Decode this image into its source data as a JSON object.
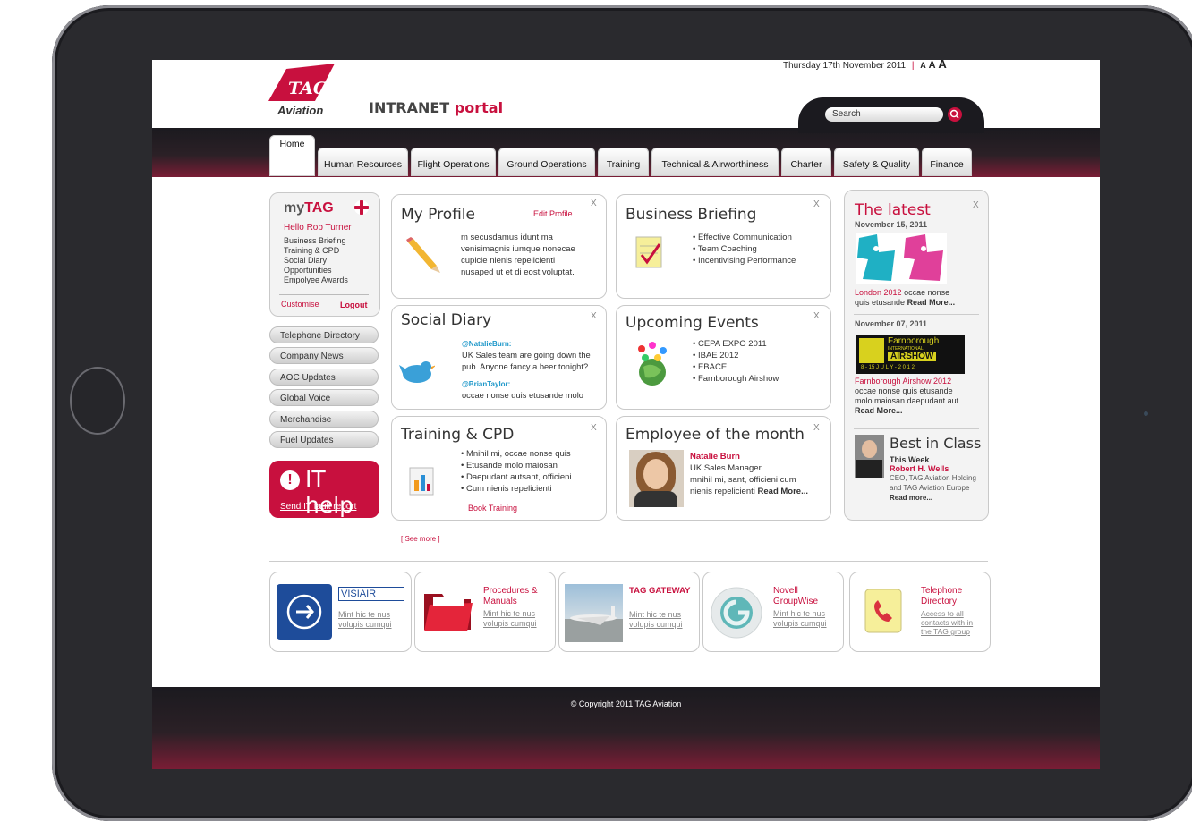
{
  "header": {
    "date": "Thursday 17th November 2011",
    "separator": "|",
    "font_size_a1": "A",
    "font_size_a2": "A",
    "font_size_a3": "A",
    "logo_text": "TAG",
    "logo_sub": "Aviation",
    "portal_word1": "INTRANET",
    "portal_word2": "portal",
    "search_label": "Search"
  },
  "tabs": [
    "Home",
    "Human Resources",
    "Flight Operations",
    "Ground Operations",
    "Training",
    "Technical & Airworthiness",
    "Charter",
    "Safety & Quality",
    "Finance"
  ],
  "mytag": {
    "title_my": "my",
    "title_tag": "TAG",
    "greeting": "Hello Rob Turner",
    "items": [
      "Business Briefing",
      "Training & CPD",
      "Social Diary",
      "Opportunities",
      "Empolyee Awards"
    ],
    "customise": "Customise",
    "logout": "Logout"
  },
  "sidenav": [
    "Telephone Directory",
    "Company News",
    "AOC Updates",
    "Global Voice",
    "Merchandise",
    "Fuel Updates"
  ],
  "ithelp": {
    "title": "IT help",
    "link": "Send IT fault report"
  },
  "profile": {
    "title": "My Profile",
    "edit": "Edit Profile",
    "close": "X",
    "text": [
      "m secusdamus idunt ma",
      "venisimagnis iumque nonecae",
      "cupicie nienis repelicienti",
      "nusaped ut et di eost voluptat."
    ]
  },
  "briefing": {
    "title": "Business Briefing",
    "close": "X",
    "items": [
      "• Effective Communication",
      "• Team Coaching",
      "• Incentivising Performance"
    ]
  },
  "social": {
    "title": "Social Diary",
    "close": "X",
    "user1": "@NatalieBurn:",
    "msg1a": "UK Sales team are going down the",
    "msg1b": "pub. Anyone fancy a beer tonight?",
    "user2": "@BrianTaylor:",
    "msg2": "occae nonse quis etusande molo"
  },
  "events": {
    "title": "Upcoming Events",
    "close": "X",
    "items": [
      "• CEPA EXPO 2011",
      "• IBAE 2012",
      "• EBACE",
      "• Farnborough Airshow"
    ]
  },
  "training": {
    "title": "Training & CPD",
    "close": "X",
    "items": [
      "• Mnihil mi, occae nonse quis",
      "• Etusande molo maiosan",
      "• Daepudant autsant, officieni",
      "• Cum nienis repelicienti"
    ],
    "book": "Book Training"
  },
  "employee": {
    "title": "Employee of the month",
    "close": "X",
    "name": "Natalie Burn",
    "role": "UK Sales Manager",
    "text1": "mnihil mi, sant, officieni cum",
    "text2": "nienis repelicienti",
    "more": "Read More..."
  },
  "see_more": "[ See more ]",
  "latest": {
    "title": "The latest",
    "close": "X",
    "date1": "November 15, 2011",
    "headline1": "London 2012",
    "text1a": "occae nonse",
    "text1b": "quis etusande",
    "more1": "Read More...",
    "date2": "November 07, 2011",
    "banner_top": "Farnborough",
    "banner_mid": "INTERNATIONAL",
    "banner_main": "AIRSHOW",
    "banner_dates": "8 - 15   J U L Y  -  2 0 1 2",
    "headline2": "Farnborough Airshow 2012",
    "text2a": "occae nonse quis etusande",
    "text2b": "molo maiosan daepudant aut",
    "more2": "Read More...",
    "bic_title": "Best in Class",
    "bic_week": "This Week",
    "bic_name": "Robert H. Wells",
    "bic_role1": "CEO, TAG Aviation Holding",
    "bic_role2": "and TAG Aviation Europe",
    "bic_more": "Read more..."
  },
  "bottom": [
    {
      "title": "VISIAIR",
      "link1": "Mint hic te nus",
      "link2": "volupis cumqui"
    },
    {
      "title1": "Procedures &",
      "title2": "Manuals",
      "link1": "Mint hic te nus",
      "link2": "volupis cumqui"
    },
    {
      "title": "TAG GATEWAY",
      "link1": "Mint hic te nus",
      "link2": "volupis cumqui"
    },
    {
      "title1": "Novell",
      "title2": "GroupWise",
      "link1": "Mint hic te nus",
      "link2": "volupis cumqui"
    },
    {
      "title1": "Telephone",
      "title2": "Directory",
      "link1": "Access to all",
      "link2": "contacts with in",
      "link3": "the TAG group"
    }
  ],
  "footer": {
    "copyright": "© Copyright 2011 TAG Aviation"
  },
  "colors": {
    "brand_red": "#c8103e",
    "dark": "#1b1a1f"
  }
}
